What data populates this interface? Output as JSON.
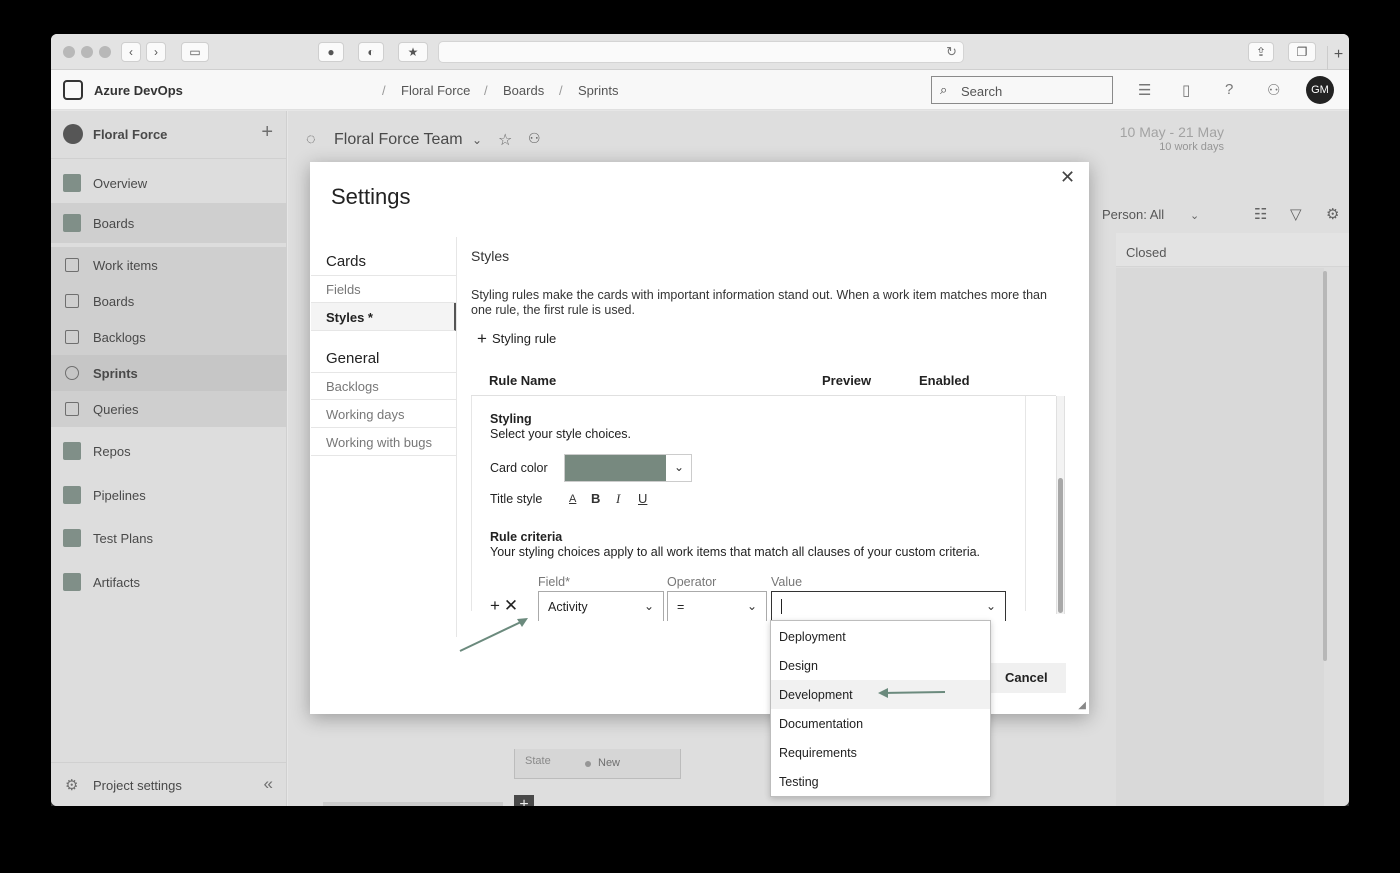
{
  "browser": {
    "tab_icons": [
      "grammarly-icon",
      "shield-icon",
      "bookmark-icon"
    ]
  },
  "topnav": {
    "brand": "Azure DevOps",
    "breadcrumbs": [
      "Floral Force",
      "Boards",
      "Sprints"
    ],
    "search_placeholder": "Search",
    "avatar_initials": "GM"
  },
  "sidebar": {
    "project": "Floral Force",
    "items": [
      {
        "label": "Overview"
      },
      {
        "label": "Boards"
      },
      {
        "label": "Work items"
      },
      {
        "label": "Boards"
      },
      {
        "label": "Backlogs"
      },
      {
        "label": "Sprints"
      },
      {
        "label": "Queries"
      },
      {
        "label": "Repos"
      },
      {
        "label": "Pipelines"
      },
      {
        "label": "Test Plans"
      },
      {
        "label": "Artifacts"
      }
    ],
    "project_settings": "Project settings"
  },
  "content": {
    "team_name": "Floral Force Team",
    "date_range": "10 May - 21 May",
    "work_days": "10 work days",
    "person_filter": "Person: All",
    "column_closed": "Closed",
    "card_state_key": "State",
    "card_state_value": "New"
  },
  "settings_modal": {
    "title": "Settings",
    "nav": {
      "cards_section": "Cards",
      "cards_items": [
        "Fields",
        "Styles *"
      ],
      "general_section": "General",
      "general_items": [
        "Backlogs",
        "Working days",
        "Working with bugs"
      ]
    },
    "styles_heading": "Styles",
    "description": "Styling rules make the cards with important information stand out. When a work item matches more than one rule, the first rule is used.",
    "add_rule": "Styling rule",
    "columns": {
      "rule_name": "Rule Name",
      "preview": "Preview",
      "enabled": "Enabled"
    },
    "styling_title": "Styling",
    "styling_desc": "Select your style choices.",
    "card_color_label": "Card color",
    "card_color_value": "#77897f",
    "title_style_label": "Title style",
    "title_style_buttons": [
      "A",
      "B",
      "I",
      "U"
    ],
    "criteria_title": "Rule criteria",
    "criteria_desc": "Your styling choices apply to all work items that match all clauses of your custom criteria.",
    "field_label": "Field*",
    "operator_label": "Operator",
    "value_label": "Value",
    "field_value": "Activity",
    "operator_value": "=",
    "value_value": "",
    "cancel": "Cancel"
  },
  "value_dropdown": {
    "options": [
      "Deployment",
      "Design",
      "Development",
      "Documentation",
      "Requirements",
      "Testing"
    ],
    "hovered": "Development"
  }
}
